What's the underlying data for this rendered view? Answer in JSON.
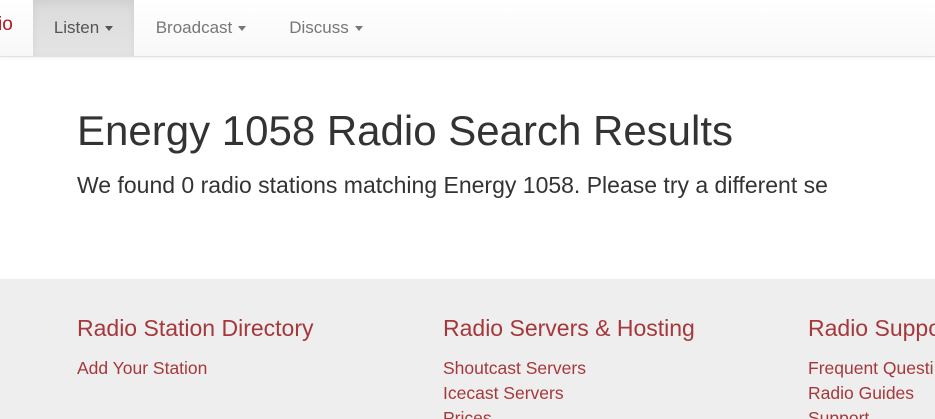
{
  "navbar": {
    "brand_fragment": "io",
    "items": [
      {
        "label": "Listen"
      },
      {
        "label": "Broadcast"
      },
      {
        "label": "Discuss"
      }
    ]
  },
  "main": {
    "title": "Energy 1058 Radio Search Results",
    "description": "We found 0 radio stations matching Energy 1058. Please try a different se"
  },
  "footer": {
    "columns": [
      {
        "heading": "Radio Station Directory",
        "links": [
          "Add Your Station"
        ]
      },
      {
        "heading": "Radio Servers & Hosting",
        "links": [
          "Shoutcast Servers",
          "Icecast Servers",
          "Prices"
        ]
      },
      {
        "heading": "Radio Suppo",
        "links": [
          "Frequent Questi",
          "Radio Guides",
          "Support"
        ]
      }
    ]
  },
  "colors": {
    "brand": "#b4151c",
    "footer_link": "#a5383c",
    "footer_bg": "#eeeeee",
    "text": "#333333"
  }
}
